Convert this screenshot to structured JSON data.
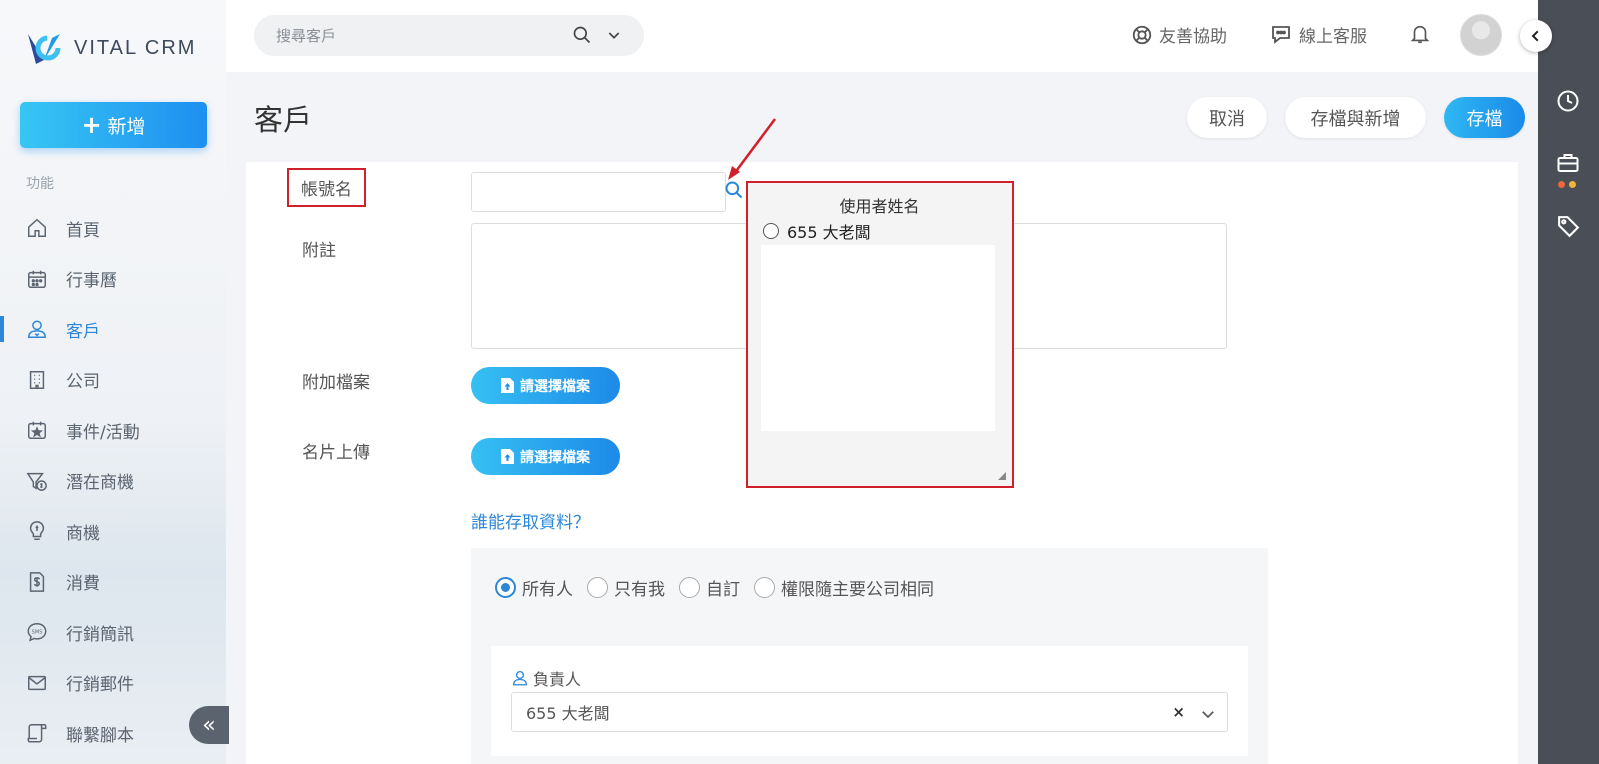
{
  "app": {
    "brand": "VITAL CRM"
  },
  "sidebar": {
    "new_button": "新增",
    "section_label": "功能",
    "items": [
      {
        "label": "首頁",
        "icon": "home-icon"
      },
      {
        "label": "行事曆",
        "icon": "calendar-icon"
      },
      {
        "label": "客戶",
        "icon": "customer-icon",
        "active": true
      },
      {
        "label": "公司",
        "icon": "building-icon"
      },
      {
        "label": "事件/活動",
        "icon": "event-icon"
      },
      {
        "label": "潛在商機",
        "icon": "funnel-icon"
      },
      {
        "label": "商機",
        "icon": "lightbulb-icon"
      },
      {
        "label": "消費",
        "icon": "receipt-icon"
      },
      {
        "label": "行銷簡訊",
        "icon": "sms-icon"
      },
      {
        "label": "行銷郵件",
        "icon": "mail-icon"
      },
      {
        "label": "聯繫腳本",
        "icon": "script-icon"
      }
    ]
  },
  "topbar": {
    "search_placeholder": "搜尋客戶",
    "help": "友善協助",
    "support": "線上客服"
  },
  "header": {
    "title": "客戶",
    "cancel": "取消",
    "save_and_new": "存檔與新增",
    "save": "存檔"
  },
  "form": {
    "account_label": "帳號名",
    "note_label": "附註",
    "attachment_label": "附加檔案",
    "card_label": "名片上傳",
    "upload_button": "請選擇檔案",
    "who_link": "誰能存取資料？",
    "access_options": [
      "所有人",
      "只有我",
      "自訂",
      "權限隨主要公司相同"
    ],
    "access_selected": "所有人",
    "owner_label": "負責人",
    "owner_value": "655 大老闆",
    "owner_clear": "×"
  },
  "popup": {
    "title": "使用者姓名",
    "option": "655 大老闆"
  },
  "colors": {
    "accent": "#2c87d8",
    "highlight": "#d0202a",
    "rail": "#4a4f57"
  }
}
